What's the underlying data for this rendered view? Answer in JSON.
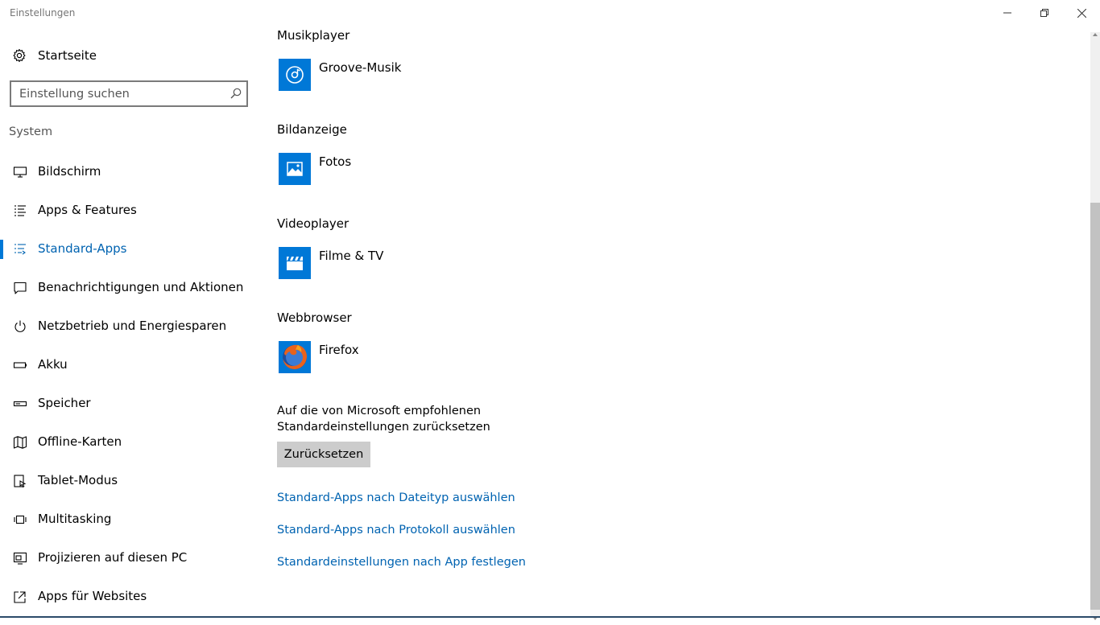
{
  "window": {
    "title": "Einstellungen"
  },
  "sidebar": {
    "home_label": "Startseite",
    "search_placeholder": "Einstellung suchen",
    "section": "System",
    "items": [
      {
        "label": "Bildschirm",
        "icon": "monitor-icon"
      },
      {
        "label": "Apps & Features",
        "icon": "list-icon"
      },
      {
        "label": "Standard-Apps",
        "icon": "default-apps-icon",
        "active": true
      },
      {
        "label": "Benachrichtigungen und Aktionen",
        "icon": "notification-icon"
      },
      {
        "label": "Netzbetrieb und Energiesparen",
        "icon": "power-icon"
      },
      {
        "label": "Akku",
        "icon": "battery-icon"
      },
      {
        "label": "Speicher",
        "icon": "storage-icon"
      },
      {
        "label": "Offline-Karten",
        "icon": "map-icon"
      },
      {
        "label": "Tablet-Modus",
        "icon": "tablet-icon"
      },
      {
        "label": "Multitasking",
        "icon": "multitasking-icon"
      },
      {
        "label": "Projizieren auf diesen PC",
        "icon": "project-icon"
      },
      {
        "label": "Apps für Websites",
        "icon": "web-apps-icon"
      }
    ]
  },
  "main": {
    "sections": [
      {
        "title": "Musikplayer",
        "app": "Groove-Musik",
        "icon": "groove-music-icon"
      },
      {
        "title": "Bildanzeige",
        "app": "Fotos",
        "icon": "photos-icon"
      },
      {
        "title": "Videoplayer",
        "app": "Filme & TV",
        "icon": "movies-tv-icon"
      },
      {
        "title": "Webbrowser",
        "app": "Firefox",
        "icon": "firefox-icon"
      }
    ],
    "reset_text": "Auf die von Microsoft empfohlenen Standardeinstellungen zurücksetzen",
    "reset_button": "Zurücksetzen",
    "links": [
      "Standard-Apps nach Dateityp auswählen",
      "Standard-Apps nach Protokoll auswählen",
      "Standardeinstellungen nach App festlegen"
    ]
  },
  "colors": {
    "accent": "#0078d7",
    "link": "#0063b1",
    "button_bg": "#cccccc"
  }
}
